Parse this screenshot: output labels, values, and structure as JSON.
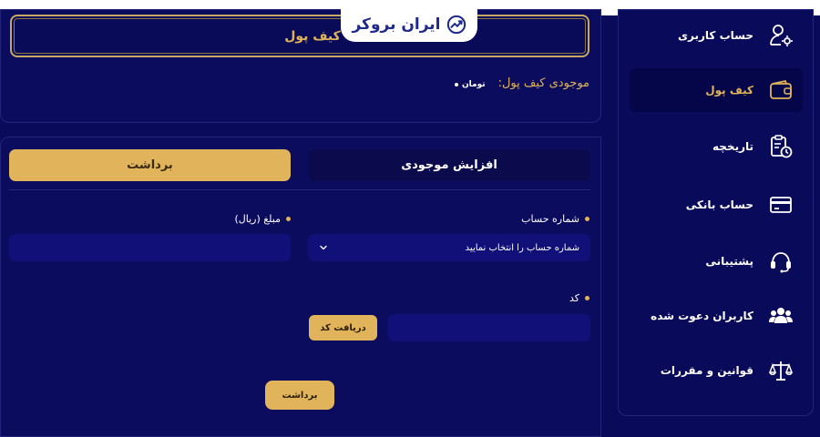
{
  "logo": {
    "text": "ایران بروکر"
  },
  "wallet": {
    "title": "کیف پول",
    "balance_label": "موجودی کیف پول:",
    "balance_unit": "تومان"
  },
  "tabs": {
    "withdraw_label": "برداشت",
    "deposit_label": "افزایش موجودی"
  },
  "form": {
    "account_label": "شماره حساب",
    "account_placeholder": "شماره حساب را انتخاب نمایید",
    "amount_label": "مبلغ (ریال)",
    "amount_value": "",
    "code_label": "کد",
    "code_value": "",
    "get_code_button": "دریافت کد",
    "submit_button": "برداشت"
  },
  "sidebar": {
    "items": [
      {
        "label": "حساب کاربری",
        "icon": "user-gear-icon"
      },
      {
        "label": "کیف پول",
        "icon": "wallet-icon",
        "active": true
      },
      {
        "label": "تاریخچه",
        "icon": "history-icon"
      },
      {
        "label": "حساب بانکی",
        "icon": "credit-card-icon"
      },
      {
        "label": "پشتیبانی",
        "icon": "headset-icon"
      },
      {
        "label": "کاربران دعوت شده",
        "icon": "users-icon"
      },
      {
        "label": "قوانین و مقررات",
        "icon": "scale-icon"
      }
    ]
  },
  "colors": {
    "background": "#0a0a5a",
    "accent_gold": "#e1b35a",
    "input_bg": "#101078",
    "tab_dark": "#0a0a4c"
  }
}
